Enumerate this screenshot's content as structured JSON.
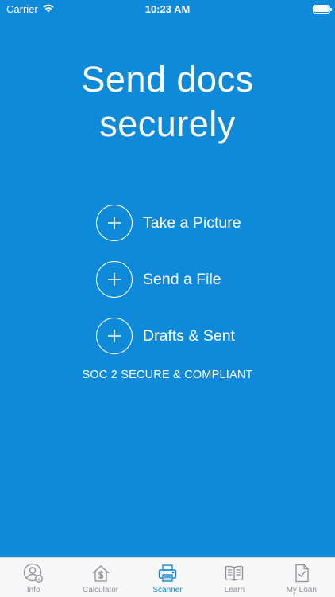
{
  "status_bar": {
    "carrier": "Carrier",
    "time": "10:23 AM"
  },
  "headline": {
    "line1": "Send docs",
    "line2": "securely"
  },
  "actions": [
    {
      "label": "Take a Picture",
      "icon": "plus-circle-icon"
    },
    {
      "label": "Send a File",
      "icon": "plus-circle-icon"
    },
    {
      "label": "Drafts & Sent",
      "icon": "plus-circle-icon"
    }
  ],
  "compliance_text": "SOC 2 SECURE & COMPLIANT",
  "tabs": [
    {
      "label": "Info",
      "icon": "user-info-icon",
      "active": false
    },
    {
      "label": "Calculator",
      "icon": "house-dollar-icon",
      "active": false
    },
    {
      "label": "Scanner",
      "icon": "printer-icon",
      "active": true
    },
    {
      "label": "Learn",
      "icon": "book-icon",
      "active": false
    },
    {
      "label": "My Loan",
      "icon": "document-check-icon",
      "active": false
    }
  ],
  "colors": {
    "background": "#0f8ad8",
    "tab_active": "#0f8ad8",
    "tab_inactive": "#8e8e93",
    "tabbar_bg": "#f7f7f7"
  }
}
